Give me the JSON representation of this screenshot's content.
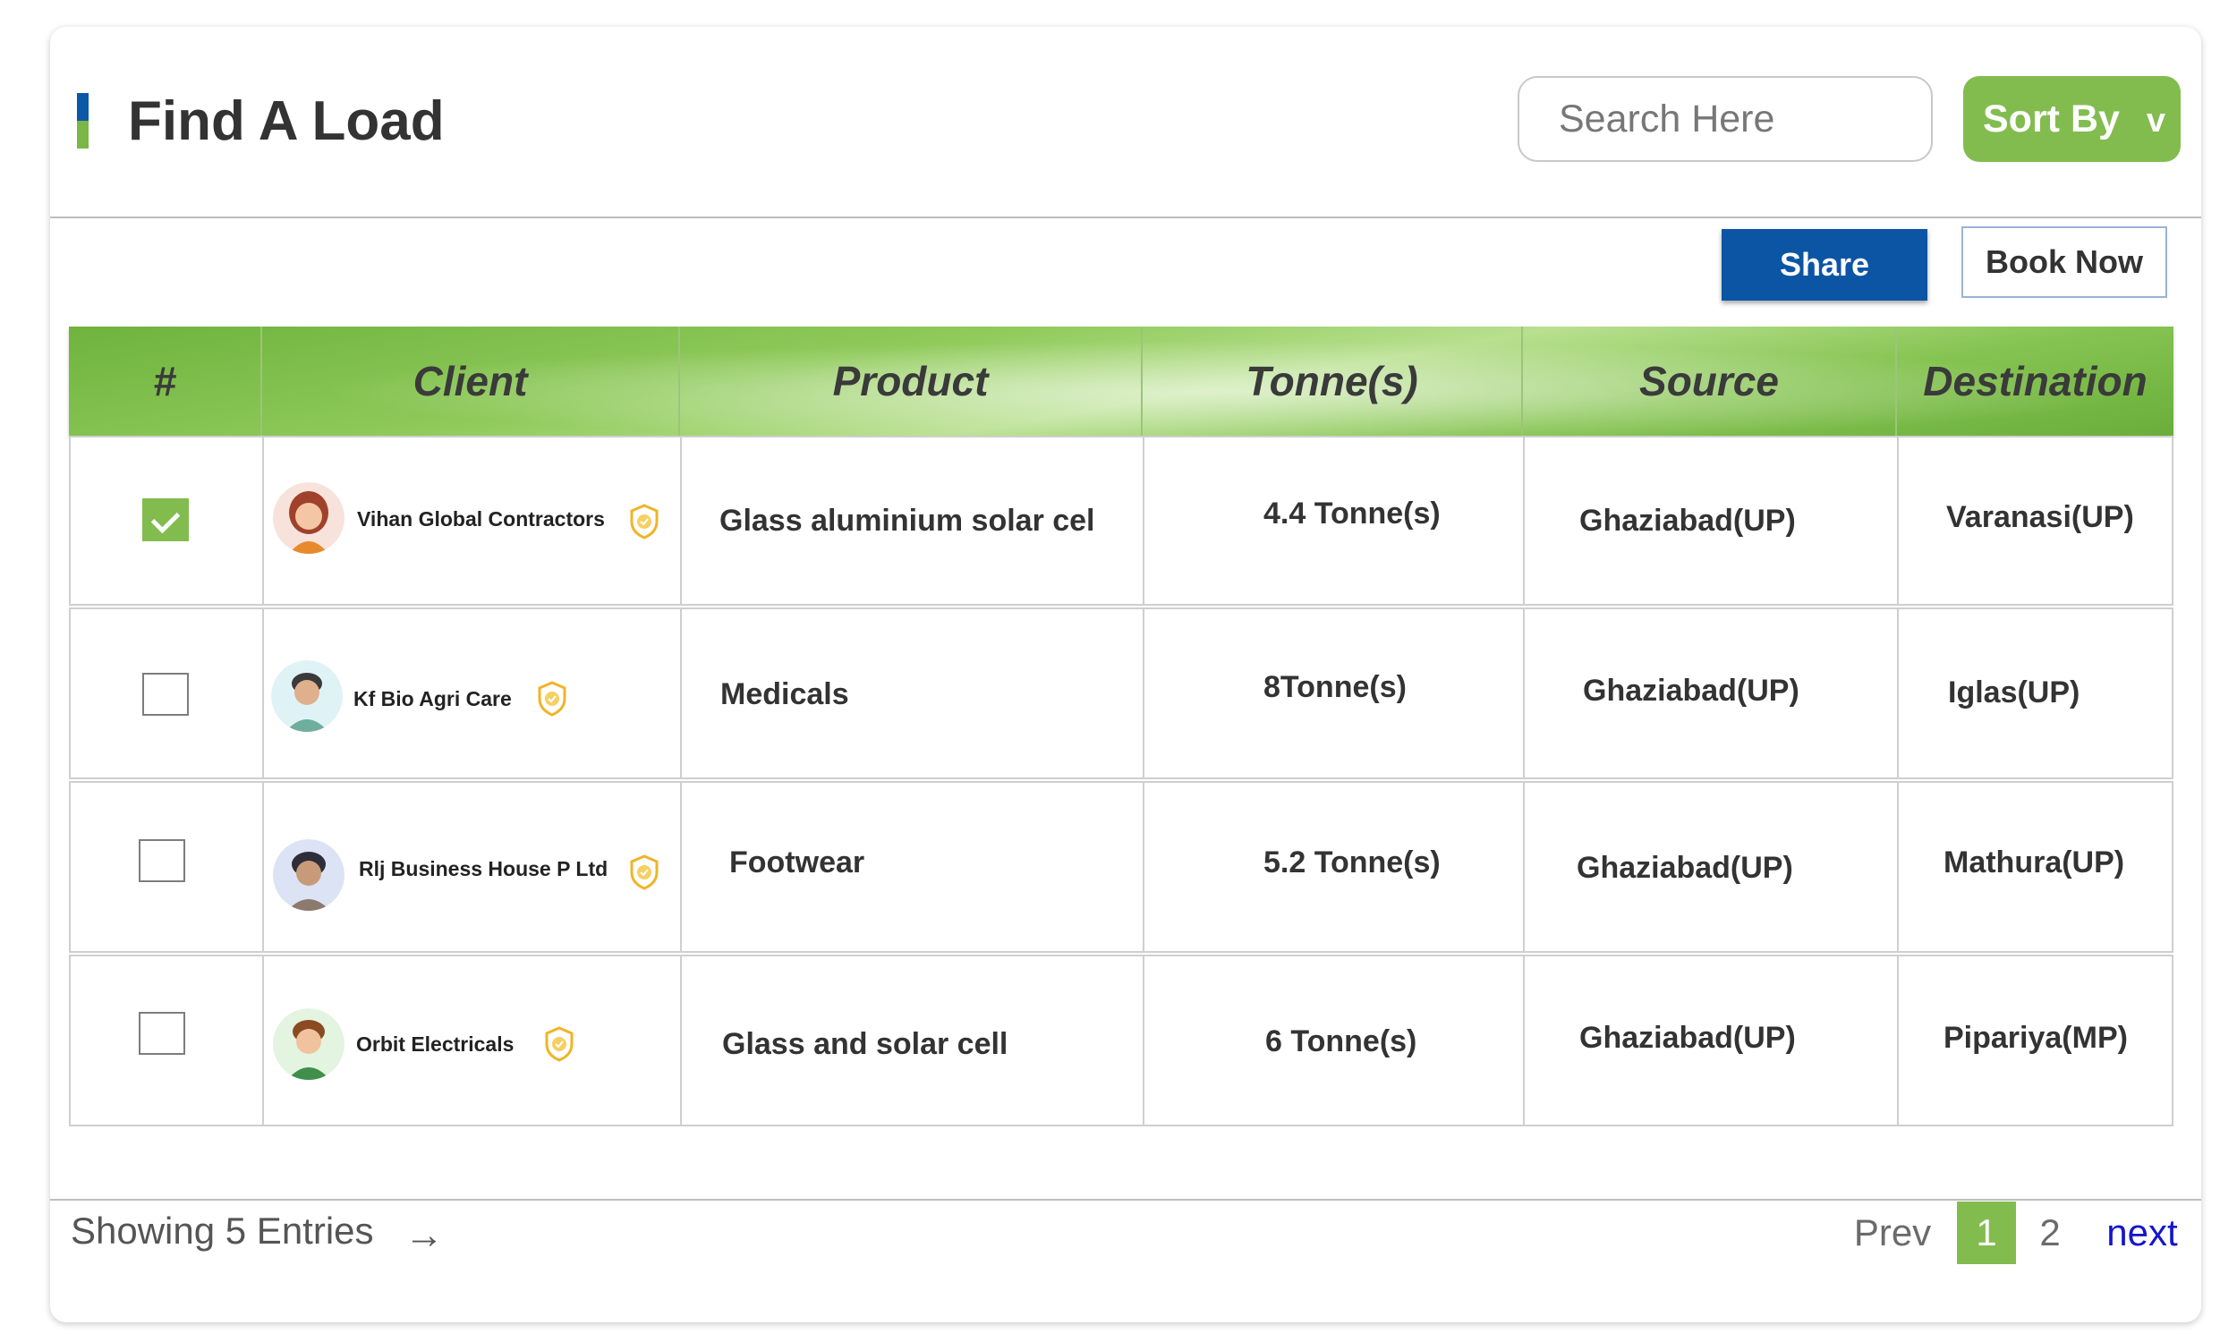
{
  "header": {
    "title": "Find A Load",
    "search_placeholder": "Search Here",
    "sort_label": "Sort By",
    "sort_chevron": "v"
  },
  "actions": {
    "share_label": "Share",
    "book_label": "Book Now"
  },
  "table": {
    "columns": [
      "#",
      "Client",
      "Product",
      "Tonne(s)",
      "Source",
      "Destination"
    ],
    "rows": [
      {
        "checked": true,
        "client": "Vihan Global Contractors",
        "verified": true,
        "product": "Glass aluminium solar cel",
        "tonnes": "4.4 Tonne(s)",
        "source": "Ghaziabad(UP)",
        "destination": "Varanasi(UP)"
      },
      {
        "checked": false,
        "client": "Kf Bio Agri Care",
        "verified": true,
        "product": "Medicals",
        "tonnes": "8Tonne(s)",
        "source": "Ghaziabad(UP)",
        "destination": "Iglas(UP)"
      },
      {
        "checked": false,
        "client": "Rlj Business House P Ltd",
        "verified": true,
        "product": "Footwear",
        "tonnes": "5.2 Tonne(s)",
        "source": "Ghaziabad(UP)",
        "destination": "Mathura(UP)"
      },
      {
        "checked": false,
        "client": "Orbit Electricals",
        "verified": true,
        "product": "Glass and solar cell",
        "tonnes": "6 Tonne(s)",
        "source": "Ghaziabad(UP)",
        "destination": "Pipariya(MP)"
      }
    ]
  },
  "footer": {
    "entries_text": "Showing 5 Entries",
    "arrow": "→",
    "pagination": {
      "prev": "Prev",
      "pages": [
        "1",
        "2"
      ],
      "current": "1",
      "next": "next"
    }
  },
  "colors": {
    "accent_green": "#82bc4e",
    "brand_blue": "#0c55a5",
    "link_blue": "#1515cc"
  },
  "icons": {
    "title_marker": "title-marker-icon",
    "verified": "verified-shield-icon",
    "arrow": "arrow-right-icon"
  }
}
